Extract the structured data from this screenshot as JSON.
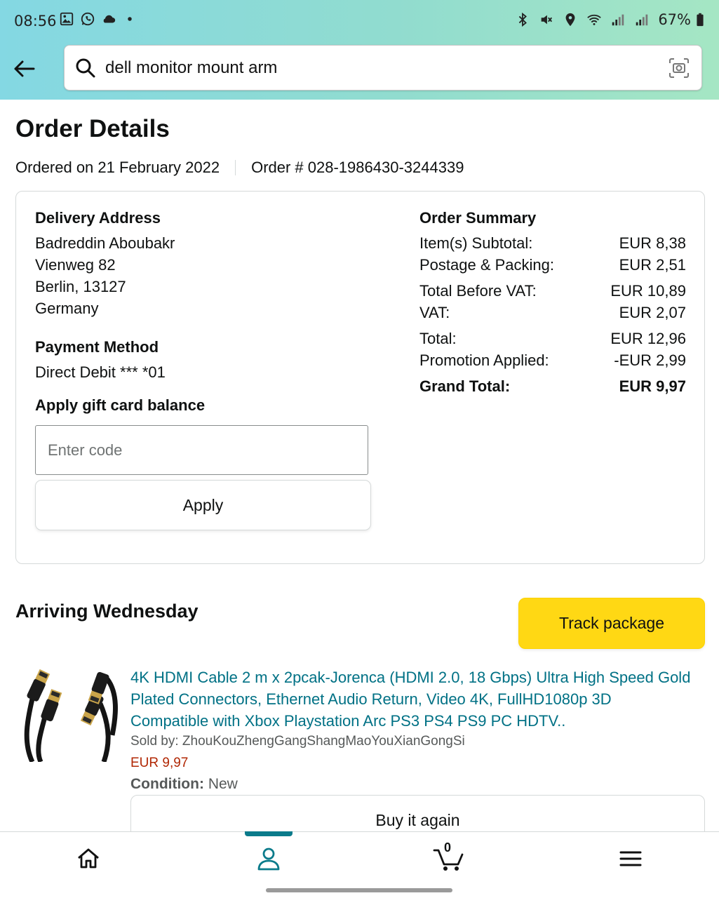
{
  "status_bar": {
    "time": "08:56",
    "battery": "67%",
    "left_icons": [
      "image-icon",
      "whatsapp-icon",
      "cloud-icon",
      "dot-icon"
    ],
    "right_icons": [
      "bluetooth-icon",
      "mute-icon",
      "location-icon",
      "wifi-icon",
      "signal-icon",
      "signal-icon",
      "battery-icon"
    ]
  },
  "search": {
    "query": "dell monitor mount arm"
  },
  "order": {
    "title": "Order Details",
    "ordered_on": "Ordered on 21 February 2022",
    "order_number": "Order # 028-1986430-3244339"
  },
  "delivery": {
    "heading": "Delivery Address",
    "lines": [
      "Badreddin Aboubakr",
      "Vienweg 82",
      "Berlin, 13127",
      "Germany"
    ]
  },
  "payment": {
    "heading": "Payment Method",
    "value": "Direct Debit *** *01"
  },
  "gift_card": {
    "heading": "Apply gift card balance",
    "placeholder": "Enter code",
    "apply_label": "Apply"
  },
  "summary": {
    "heading": "Order Summary",
    "rows": [
      {
        "label": "Item(s) Subtotal:",
        "value": "EUR 8,38"
      },
      {
        "label": "Postage & Packing:",
        "value": "EUR 2,51"
      },
      {
        "label": "Total Before VAT:",
        "value": "EUR 10,89"
      },
      {
        "label": "VAT:",
        "value": "EUR 2,07"
      },
      {
        "label": "Total:",
        "value": "EUR 12,96"
      },
      {
        "label": "Promotion Applied:",
        "value": "-EUR 2,99"
      },
      {
        "label": "Grand Total:",
        "value": "EUR 9,97"
      }
    ]
  },
  "shipment": {
    "status": "Arriving Wednesday",
    "track_label": "Track package",
    "product": {
      "title": "4K HDMI Cable 2 m x 2pcak-Jorenca (HDMI 2.0, 18 Gbps) Ultra High Speed Gold Plated Connectors, Ethernet Audio Return, Video 4K, FullHD1080p 3D Compatible with Xbox Playstation Arc PS3 PS4 PS9 PC HDTV..",
      "sold_by": "Sold by: ZhouKouZhengGangShangMaoYouXianGongSi",
      "price": "EUR 9,97",
      "condition_label": "Condition:",
      "condition_value": "New",
      "buy_again_label": "Buy it again"
    }
  },
  "bottom_nav": {
    "cart_count": "0",
    "active": "account",
    "accent": "#0b7b8b"
  },
  "colors": {
    "link": "#007185",
    "price": "#b12704",
    "track_button": "#ffd814"
  }
}
